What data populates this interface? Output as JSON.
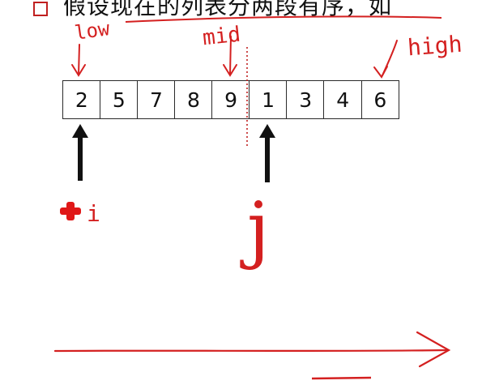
{
  "slide": {
    "title": "假设现在的列表分两段有序，如"
  },
  "array": {
    "values": [
      "2",
      "5",
      "7",
      "8",
      "9",
      "1",
      "3",
      "4",
      "6"
    ]
  },
  "annotations": {
    "low": "low",
    "mid": "mid",
    "high": "high",
    "i": "i",
    "j": "j"
  },
  "colors": {
    "ink_red": "#d42020",
    "ink_black": "#111111"
  }
}
